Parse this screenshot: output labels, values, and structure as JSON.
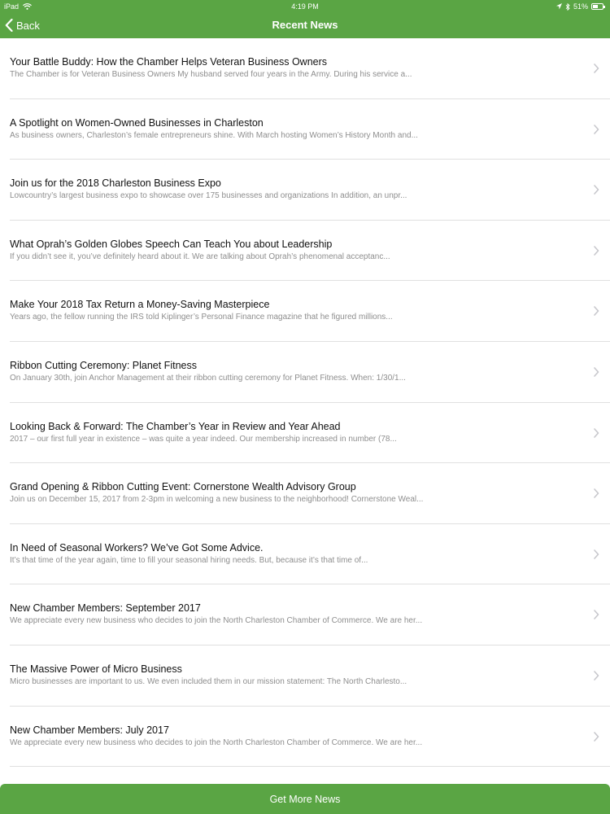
{
  "status_bar": {
    "device": "iPad",
    "time": "4:19 PM",
    "battery": "51%",
    "battery_level": 0.51,
    "icons": [
      "wifi-icon",
      "location-arrow-icon",
      "bluetooth-icon",
      "battery-icon"
    ]
  },
  "nav": {
    "back_label": "Back",
    "title": "Recent News"
  },
  "news": [
    {
      "title": "Your Battle Buddy: How the Chamber Helps Veteran Business Owners",
      "summary": "The Chamber is for Veteran Business Owners My husband served four years in the Army. During his service a..."
    },
    {
      "title": "A Spotlight on Women-Owned Businesses in Charleston",
      "summary": "As business owners, Charleston’s female entrepreneurs shine. With March hosting Women’s History Month and..."
    },
    {
      "title": "Join us for the 2018 Charleston Business Expo",
      "summary": "Lowcountry’s largest business expo to showcase over 175 businesses and organizations In addition, an unpr..."
    },
    {
      "title": "What Oprah’s Golden Globes Speech Can Teach You about Leadership",
      "summary": "If you didn’t see it, you’ve definitely heard about it. We are talking about Oprah’s phenomenal acceptanc..."
    },
    {
      "title": "Make Your 2018 Tax Return a Money-Saving Masterpiece",
      "summary": "Years ago, the fellow running the IRS told Kiplinger’s Personal Finance magazine that he figured millions..."
    },
    {
      "title": "Ribbon Cutting Ceremony: Planet Fitness",
      "summary": "On January 30th, join Anchor Management at their ribbon cutting ceremony for Planet Fitness. When: 1/30/1..."
    },
    {
      "title": "Looking Back & Forward: The Chamber’s Year in Review and Year Ahead",
      "summary": "2017 – our first full year in existence – was quite a year indeed. Our membership increased in number (78..."
    },
    {
      "title": "Grand Opening & Ribbon Cutting Event: Cornerstone Wealth Advisory Group",
      "summary": "Join us on December 15, 2017 from 2-3pm in welcoming a new business to the neighborhood! Cornerstone Weal..."
    },
    {
      "title": "In Need of Seasonal Workers? We’ve Got Some Advice.",
      "summary": "It’s that time of the year again, time to fill your seasonal hiring needs. But, because it’s that time of..."
    },
    {
      "title": "New Chamber Members: September 2017",
      "summary": "We appreciate every new business who decides to join the North Charleston Chamber of Commerce. We are her..."
    },
    {
      "title": "The Massive Power of Micro Business",
      "summary": "Micro businesses are important to us. We even included them in our mission statement: The North Charlesto..."
    },
    {
      "title": "New Chamber Members: July 2017",
      "summary": "We appreciate every new business who decides to join the North Charleston Chamber of Commerce. We are her..."
    }
  ],
  "footer": {
    "more_label": "Get More News"
  },
  "colors": {
    "accent": "#5aa544",
    "chevron": "#c7c7cc"
  }
}
